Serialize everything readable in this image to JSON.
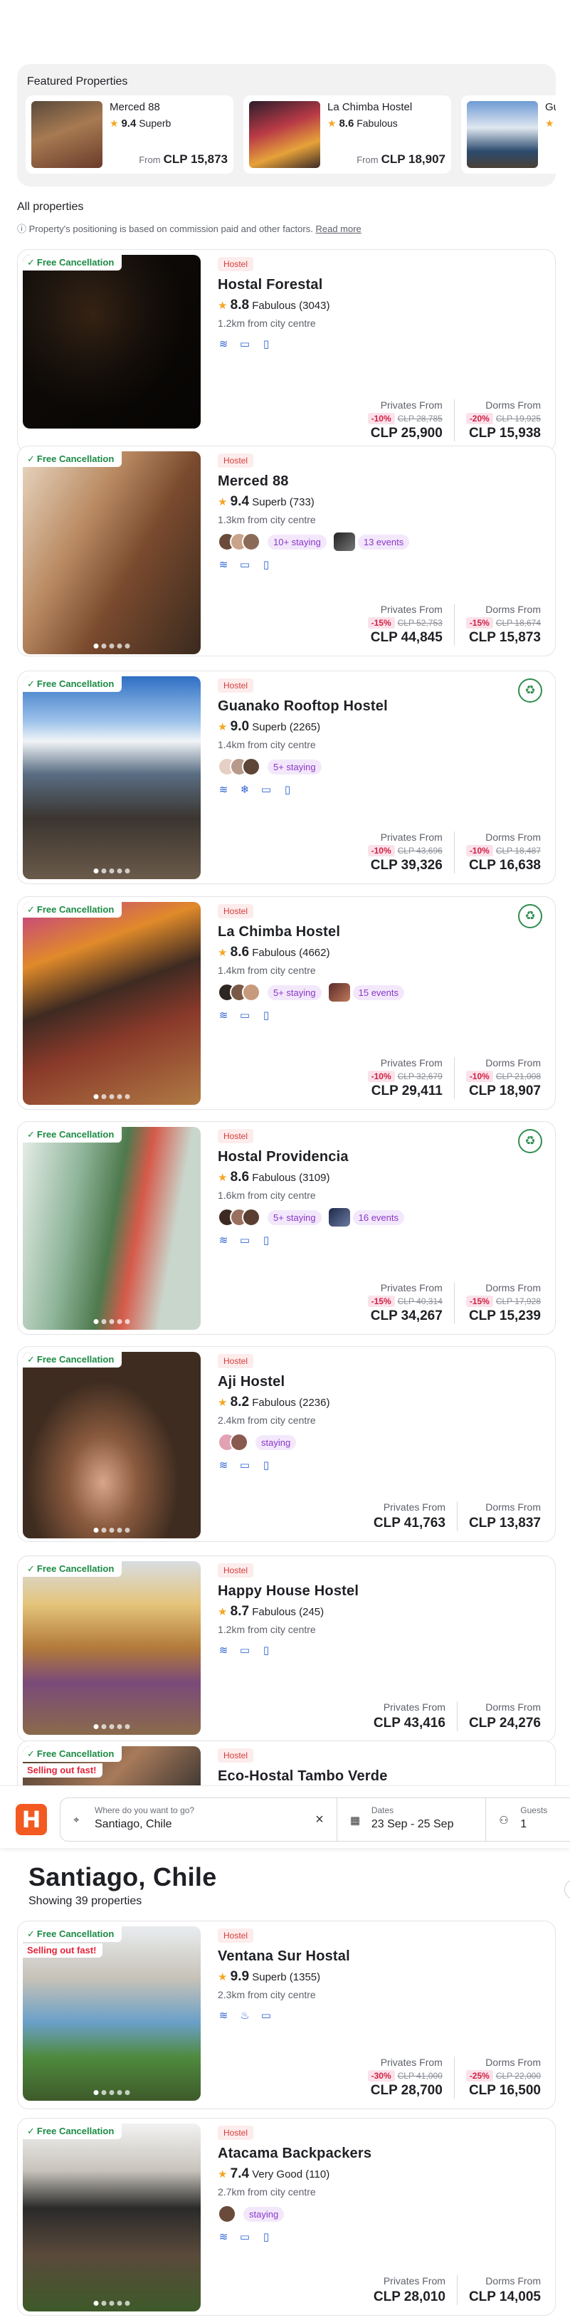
{
  "featured": {
    "title": "Featured Properties",
    "items": [
      {
        "name": "Merced 88",
        "score": "9.4",
        "label": "Superb",
        "from": "From",
        "price": "CLP 15,873"
      },
      {
        "name": "La Chimba Hostel",
        "score": "8.6",
        "label": "Fabulous",
        "from": "From",
        "price": "CLP 18,907"
      },
      {
        "name": "Guanako Rooftop Hostel",
        "score": "",
        "label": "",
        "from": "",
        "price": ""
      }
    ]
  },
  "list": {
    "heading": "All properties",
    "disclaimer": "Property's positioning is based on commission paid and other factors.",
    "read_more": "Read more"
  },
  "labels": {
    "free_cancel": "Free Cancellation",
    "selling_fast": "Selling out fast!",
    "type": "Hostel",
    "privates": "Privates From",
    "dorms": "Dorms From"
  },
  "properties": [
    {
      "name": "Hostal Forestal",
      "score": "8.8",
      "label": "Fabulous",
      "reviews": "(3043)",
      "distance": "1.2km from city centre",
      "priv_disc": "-10%",
      "priv_old": "CLP 28,785",
      "priv_price": "CLP 25,900",
      "dorm_disc": "-20%",
      "dorm_old": "CLP 19,925",
      "dorm_price": "CLP 15,938"
    },
    {
      "name": "Merced 88",
      "score": "9.4",
      "label": "Superb",
      "reviews": "(733)",
      "distance": "1.3km from city centre",
      "staying": "10+ staying",
      "events": "13 events",
      "priv_disc": "-15%",
      "priv_old": "CLP 52,753",
      "priv_price": "CLP 44,845",
      "dorm_disc": "-15%",
      "dorm_old": "CLP 18,674",
      "dorm_price": "CLP 15,873"
    },
    {
      "name": "Guanako Rooftop Hostel",
      "score": "9.0",
      "label": "Superb",
      "reviews": "(2265)",
      "distance": "1.4km from city centre",
      "staying": "5+ staying",
      "priv_disc": "-10%",
      "priv_old": "CLP 43,696",
      "priv_price": "CLP 39,326",
      "dorm_disc": "-10%",
      "dorm_old": "CLP 18,487",
      "dorm_price": "CLP 16,638"
    },
    {
      "name": "La Chimba Hostel",
      "score": "8.6",
      "label": "Fabulous",
      "reviews": "(4662)",
      "distance": "1.4km from city centre",
      "staying": "5+ staying",
      "events": "15 events",
      "priv_disc": "-10%",
      "priv_old": "CLP 32,679",
      "priv_price": "CLP 29,411",
      "dorm_disc": "-10%",
      "dorm_old": "CLP 21,008",
      "dorm_price": "CLP 18,907"
    },
    {
      "name": "Hostal Providencia",
      "score": "8.6",
      "label": "Fabulous",
      "reviews": "(3109)",
      "distance": "1.6km from city centre",
      "staying": "5+ staying",
      "events": "16 events",
      "priv_disc": "-15%",
      "priv_old": "CLP 40,314",
      "priv_price": "CLP 34,267",
      "dorm_disc": "-15%",
      "dorm_old": "CLP 17,928",
      "dorm_price": "CLP 15,239"
    },
    {
      "name": "Aji Hostel",
      "score": "8.2",
      "label": "Fabulous",
      "reviews": "(2236)",
      "distance": "2.4km from city centre",
      "staying": "staying",
      "priv_price": "CLP 41,763",
      "dorm_price": "CLP 13,837"
    },
    {
      "name": "Happy House Hostel",
      "score": "8.7",
      "label": "Fabulous",
      "reviews": "(245)",
      "distance": "1.2km from city centre",
      "priv_price": "CLP 43,416",
      "dorm_price": "CLP 24,276"
    },
    {
      "name": "Eco-Hostal Tambo Verde"
    },
    {
      "name": "Ventana Sur Hostal",
      "score": "9.9",
      "label": "Superb",
      "reviews": "(1355)",
      "distance": "2.3km from city centre",
      "priv_disc": "-30%",
      "priv_old": "CLP 41,000",
      "priv_price": "CLP 28,700",
      "dorm_disc": "-25%",
      "dorm_old": "CLP 22,000",
      "dorm_price": "CLP 16,500"
    },
    {
      "name": "Atacama Backpackers",
      "score": "7.4",
      "label": "Very Good",
      "reviews": "(110)",
      "distance": "2.7km from city centre",
      "staying": "staying",
      "priv_price": "CLP 28,010",
      "dorm_price": "CLP 14,005"
    }
  ],
  "search": {
    "logo": "H",
    "where_label": "Where do you want to go?",
    "where_value": "Santiago, Chile",
    "dates_label": "Dates",
    "dates_value": "23 Sep - 25 Sep",
    "guests_label": "Guests",
    "guests_value": "1"
  },
  "results": {
    "city": "Santiago, Chile",
    "count": "Showing 39 properties"
  },
  "colors": {
    "accent": "#f25a22",
    "price_discount": "#d11f45",
    "free_cancel": "#1a8a43",
    "amenity": "#2e63d1",
    "staying": "#8a38c8"
  }
}
